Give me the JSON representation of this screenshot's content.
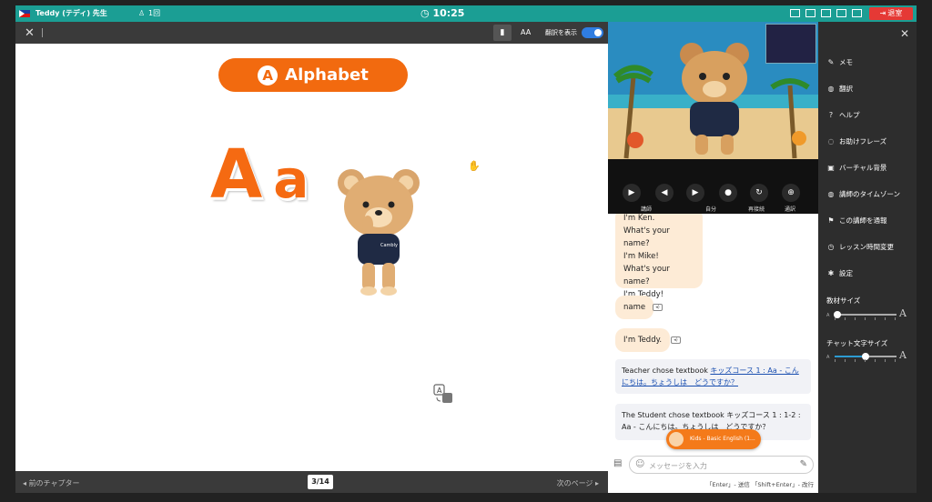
{
  "topbar": {
    "teacher": "Teddy (テディ) 先生",
    "count": "1回",
    "clock": "10:25",
    "exit": "退室"
  },
  "material": {
    "translate_label": "翻訳を表示",
    "aa_label": "AA",
    "title": "Alphabet",
    "title_letter": "A",
    "letter_upper": "A",
    "letter_lower": "a",
    "shirt_text": "Cambly",
    "prev": "前のチャプター",
    "page": "3/14",
    "next": "次のページ"
  },
  "controls": {
    "teacher_label": "講師",
    "self_label": "自分",
    "reconnect_label": "再接続",
    "call_label": "通訳"
  },
  "chat": {
    "bubble_lines": [
      "I'm Ken.",
      "What's your name?",
      "I'm Mike!",
      "What's your name?",
      "I'm Teddy!"
    ],
    "msg_name": "name",
    "msg_teddy": "I'm Teddy.",
    "sys1_prefix": "Teacher chose textbook ",
    "sys1_link": "キッズコース 1 : Aa - こんにちは。ちょうしは　どうですか？",
    "sys2": "The Student chose textbook キッズコース 1 : 1-2 : Aa - こんにちは。ちょうしは　どうですか？",
    "kids_pill": "Kids - Basic English (1...",
    "placeholder": "メッセージを入力",
    "hint": "「Enter」- 送信 「Shift+Enter」- 改行"
  },
  "side": {
    "menu": [
      {
        "icon": "memo-icon",
        "label": "メモ"
      },
      {
        "icon": "translate-icon",
        "label": "翻訳"
      },
      {
        "icon": "help-icon",
        "label": "ヘルプ"
      },
      {
        "icon": "chat-phrases-icon",
        "label": "お助けフレーズ"
      },
      {
        "icon": "image-icon",
        "label": "バーチャル背景"
      },
      {
        "icon": "globe-icon",
        "label": "講師のタイムゾーン"
      },
      {
        "icon": "flag-icon",
        "label": "この講師を通報"
      },
      {
        "icon": "clock-icon",
        "label": "レッスン時間変更"
      },
      {
        "icon": "gear-icon",
        "label": "設定"
      }
    ],
    "material_size_label": "教材サイズ",
    "material_size_level": 0.05,
    "chat_size_label": "チャット文字サイズ",
    "chat_size_level": 0.5,
    "small_a": "A",
    "big_a": "A"
  },
  "colors": {
    "topbar": "#1b9e94",
    "accent_orange": "#f26a0f",
    "exit_red": "#e53935",
    "link_blue": "#1a4fb0"
  }
}
